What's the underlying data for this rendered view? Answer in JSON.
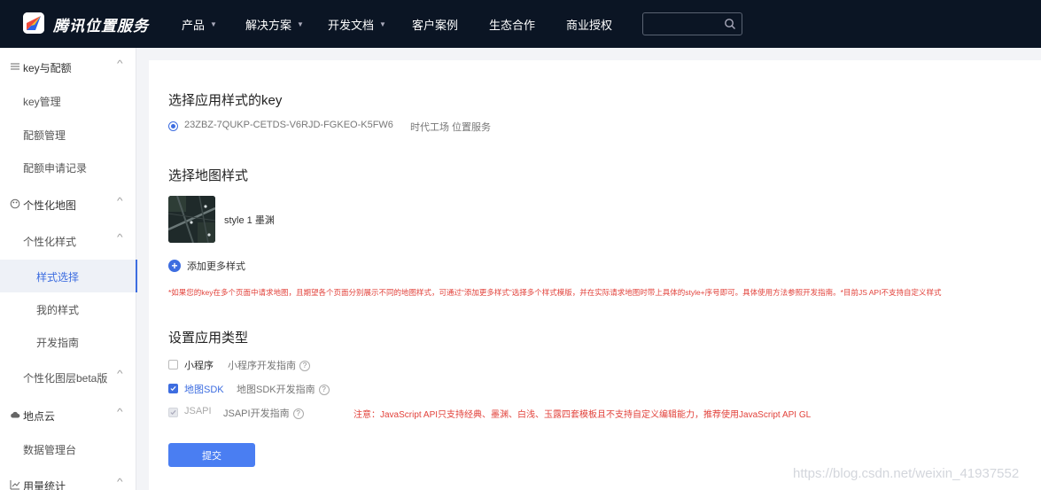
{
  "header": {
    "brand": "腾讯位置服务",
    "nav": [
      {
        "label": "产品",
        "dropdown": true
      },
      {
        "label": "解决方案",
        "dropdown": true
      },
      {
        "label": "开发文档",
        "dropdown": true
      },
      {
        "label": "客户案例",
        "dropdown": false
      },
      {
        "label": "生态合作",
        "dropdown": false
      },
      {
        "label": "商业授权",
        "dropdown": false
      }
    ],
    "search_value": ""
  },
  "sidebar": {
    "key_group": "key与配额",
    "key_manage": "key管理",
    "quota_manage": "配额管理",
    "quota_record": "配额申请记录",
    "map_group": "个性化地图",
    "style_sub": "个性化样式",
    "style_select": "样式选择",
    "my_style": "我的样式",
    "dev_guide": "开发指南",
    "layer_beta": "个性化图层beta版",
    "poi_group": "地点云",
    "data_console": "数据管理台",
    "usage_group": "用量统计"
  },
  "main": {
    "key_title": "选择应用样式的key",
    "key_value": "23ZBZ-7QUKP-CETDS-V6RJD-FGKEO-K5FW6",
    "key_desc": "时代工场 位置服务",
    "style_title": "选择地图样式",
    "style_name": "style 1 墨渊",
    "add_more": "添加更多样式",
    "notice": "*如果您的key在多个页面中请求地图，且期望各个页面分别展示不同的地图样式，可通过“添加更多样式”选择多个样式模版，并在实际请求地图时带上具体的style+序号即可。具体使用方法参照开发指南。*目前JS API不支持自定义样式",
    "type_title": "设置应用类型",
    "types": [
      {
        "label": "小程序",
        "guide": "小程序开发指南",
        "checked": false
      },
      {
        "label": "地图SDK",
        "guide": "地图SDK开发指南",
        "checked": true
      },
      {
        "label": "JSAPI",
        "guide": "JSAPI开发指南",
        "checked": true
      }
    ],
    "jsapi_warning": "注意：JavaScript API只支持经典、墨渊、白浅、玉露四套模板且不支持自定义编辑能力，推荐使用JavaScript API GL",
    "submit": "提交"
  },
  "watermark": "https://blog.csdn.net/weixin_41937552",
  "colors": {
    "accent": "#3d6de0",
    "topbar": "#0b1524",
    "warning": "#e2423b"
  }
}
